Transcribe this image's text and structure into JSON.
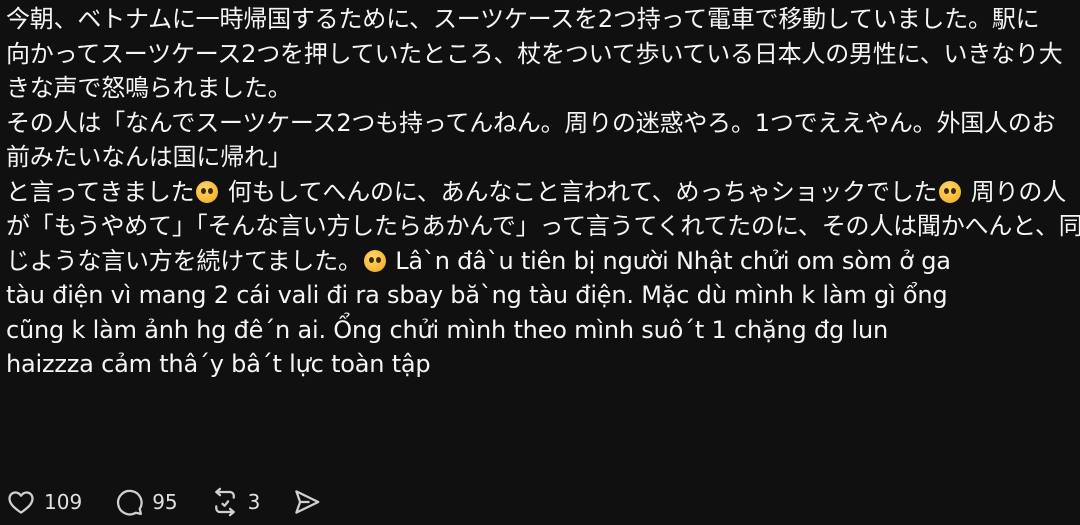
{
  "post": {
    "lines": [
      "今朝、ベトナムに一時帰国するために、スーツケースを2つ持って電車で移動していました。駅に",
      "向かってスーツケース2つを押していたところ、杖をついて歩いている日本人の男性に、いきなり大",
      "きな声で怒鳴られました。",
      "その人は「なんでスーツケース2つも持ってんねん。周りの迷惑やろ。1つでええやん。外国人のお",
      "前みたいなんは国に帰れ」"
    ],
    "line6a": "と言ってきました",
    "line6b": " 何もしてへんのに、あんなこと言われて、めっちゃショックでした",
    "line6c": " 周りの人",
    "line7": "が「もうやめて」「そんな言い方したらあかんで」って言うてくれてたのに、その人は聞かへんと、同",
    "line8a": "じような言い方を続けてました。",
    "line8b": " Lâ`n đâ`u tiên bị người Nhật chửi om sòm ở ga",
    "lines_tail": [
      "tàu điện vì mang 2 cái vali đi ra sbay bă`ng tàu điện. Mặc dù mình k làm gì ổng",
      "cũng k làm ảnh hg đê´n ai. Ổng chửi mình theo mình suô´t 1 chặng đg lun",
      "haizzza cảm thâ´y bâ´t lực toàn tập"
    ]
  },
  "actions": {
    "like_count": "109",
    "reply_count": "95",
    "repost_count": "3"
  },
  "icons": [
    "heart-icon",
    "comment-icon",
    "repost-icon",
    "share-icon",
    "pleading-face-emoji",
    "sad-face-emoji",
    "flushed-face-emoji"
  ]
}
